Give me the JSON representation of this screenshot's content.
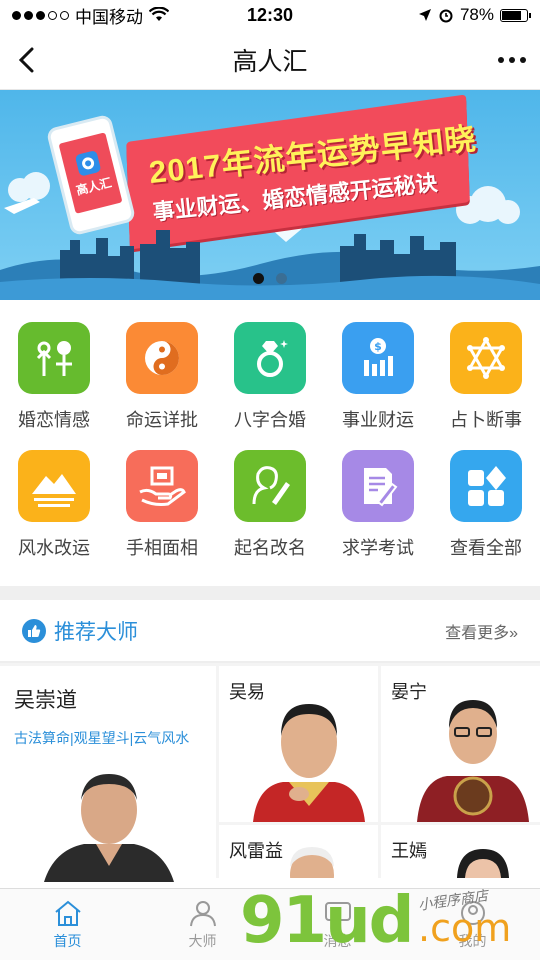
{
  "status_bar": {
    "carrier": "中国移动",
    "time": "12:30",
    "battery": "78%",
    "battery_level": 0.78
  },
  "nav": {
    "title": "高人汇"
  },
  "banner": {
    "headline": "2017年流年运势早知晓",
    "subline": "事业财运、婚恋情感开运秘诀",
    "app_name": "高人汇",
    "slide_count": 2,
    "active_slide": 0
  },
  "services": [
    {
      "label": "婚恋情感",
      "icon": "love-balloons-icon",
      "color": "#66bb2e"
    },
    {
      "label": "命运详批",
      "icon": "yin-yang-icon",
      "color": "#fb8a35"
    },
    {
      "label": "八字合婚",
      "icon": "diamond-ring-icon",
      "color": "#28c28a"
    },
    {
      "label": "事业财运",
      "icon": "money-chart-icon",
      "color": "#3a9ff0"
    },
    {
      "label": "占卜断事",
      "icon": "hexagram-icon",
      "color": "#fbb21a"
    },
    {
      "label": "风水改运",
      "icon": "mountain-icon",
      "color": "#fbb21a"
    },
    {
      "label": "手相面相",
      "icon": "palm-icon",
      "color": "#f76d5a"
    },
    {
      "label": "起名改名",
      "icon": "profile-pen-icon",
      "color": "#6cbd2c"
    },
    {
      "label": "求学考试",
      "icon": "document-pen-icon",
      "color": "#a689e6"
    },
    {
      "label": "查看全部",
      "icon": "all-apps-icon",
      "color": "#35a7ee"
    }
  ],
  "recommended": {
    "title": "推荐大师",
    "more": "查看更多»"
  },
  "masters": {
    "main": {
      "name": "吴崇道",
      "tags": "古法算命|观星望斗|云气风水"
    },
    "cards": [
      {
        "name": "吴易"
      },
      {
        "name": "晏宁"
      },
      {
        "name": "风雷益"
      },
      {
        "name": "王嫣"
      }
    ]
  },
  "tabs": [
    {
      "label": "首页",
      "icon": "home-icon",
      "active": true
    },
    {
      "label": "大师",
      "icon": "master-icon",
      "active": false
    },
    {
      "label": "消息",
      "icon": "message-icon",
      "active": false
    },
    {
      "label": "我的",
      "icon": "user-icon",
      "active": false
    }
  ],
  "watermark": {
    "main": "91ud",
    "domain": ".com",
    "script": "小程序商店"
  }
}
